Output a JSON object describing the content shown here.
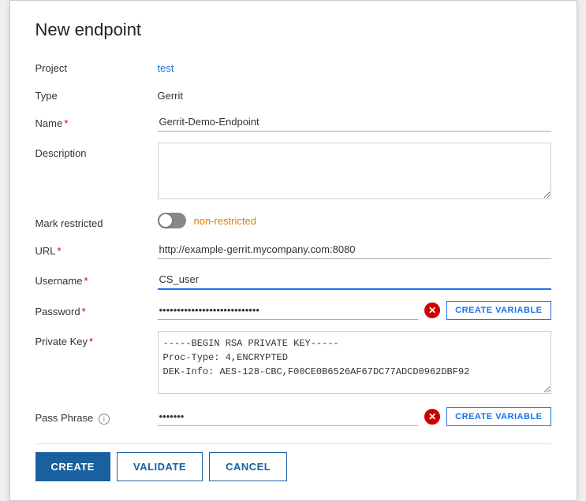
{
  "dialog": {
    "title": "New endpoint"
  },
  "fields": {
    "project_label": "Project",
    "project_value": "test",
    "type_label": "Type",
    "type_value": "Gerrit",
    "name_label": "Name",
    "name_required": "*",
    "name_value": "Gerrit-Demo-Endpoint",
    "description_label": "Description",
    "description_value": "",
    "description_placeholder": "",
    "mark_restricted_label": "Mark restricted",
    "mark_restricted_status": "non-restricted",
    "url_label": "URL",
    "url_required": "*",
    "url_value": "http://example-gerrit.mycompany.com:8080",
    "username_label": "Username",
    "username_required": "*",
    "username_value": "CS_user",
    "password_label": "Password",
    "password_required": "*",
    "password_dots": "••••••••••••••••••••••••••••",
    "private_key_label": "Private Key",
    "private_key_required": "*",
    "private_key_line1": "-----BEGIN RSA PRIVATE KEY-----",
    "private_key_line2": "Proc-Type: 4,ENCRYPTED",
    "private_key_line3": "DEK-Info: AES-128-CBC,F00CE0B6526AF67DC77ADCD0962DBF92",
    "pass_phrase_label": "Pass Phrase",
    "pass_phrase_dots": "•••••••",
    "create_variable_label": "CREATE VARIABLE",
    "create_variable_label2": "CREATE VARIABLE"
  },
  "buttons": {
    "create": "CREATE",
    "validate": "VALIDATE",
    "cancel": "CANCEL"
  }
}
